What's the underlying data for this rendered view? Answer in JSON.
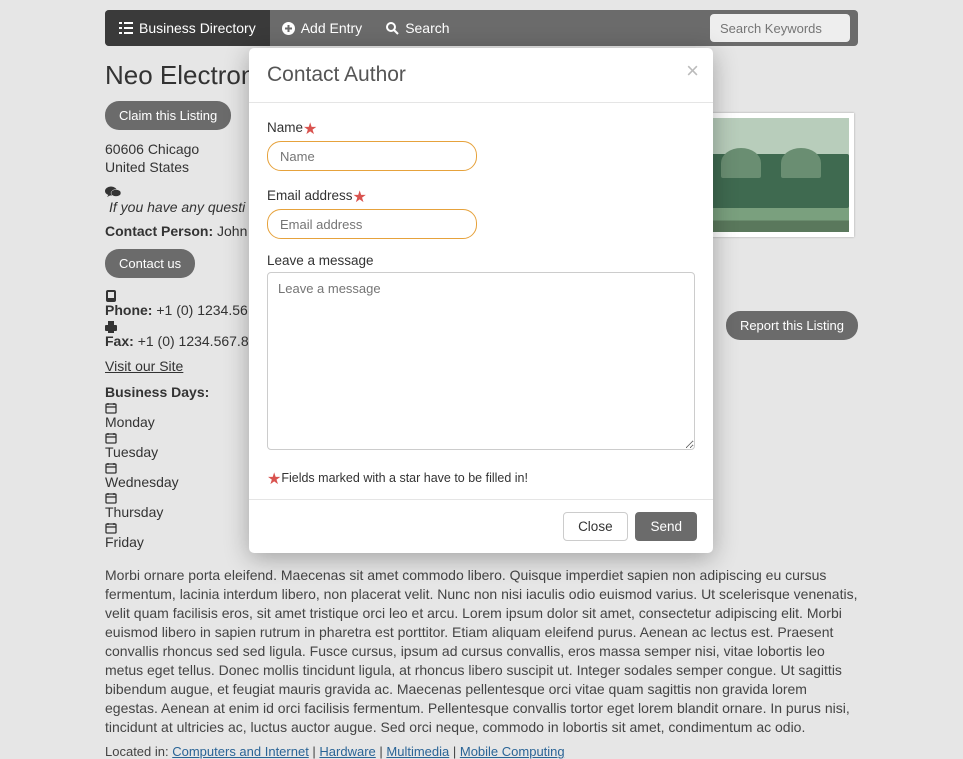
{
  "nav": {
    "directory_label": "Business Directory",
    "add_entry_label": "Add Entry",
    "search_label": "Search",
    "search_placeholder": "Search Keywords"
  },
  "listing": {
    "title": "Neo Electronics",
    "claim_label": "Claim this Listing",
    "address_line1": "60606 Chicago",
    "address_line2": "United States",
    "question_text": "If you have any questi",
    "contact_person_label": "Contact Person:",
    "contact_person_value": "John D",
    "contact_us_label": "Contact us",
    "phone_label": "Phone:",
    "phone_value": "+1 (0) 1234.56",
    "fax_label": "Fax:",
    "fax_value": "+1 (0) 1234.567.8",
    "visit_label": "Visit our Site",
    "bdays_title": "Business Days:",
    "bdays": [
      "Monday",
      "Tuesday",
      "Wednesday",
      "Thursday",
      "Friday"
    ],
    "report_label": "Report this Listing",
    "body": "Morbi ornare porta eleifend. Maecenas sit amet commodo libero. Quisque imperdiet sapien non adipiscing eu cursus fermentum, lacinia interdum libero, non placerat velit. Nunc non nisi iaculis odio euismod varius. Ut scelerisque venenatis, velit quam facilisis eros, sit amet tristique orci leo et arcu. Lorem ipsum dolor sit amet, consectetur adipiscing elit. Morbi euismod libero in sapien rutrum in pharetra est porttitor. Etiam aliquam eleifend purus. Aenean ac lectus est. Praesent convallis rhoncus sed sed ligula. Fusce cursus, ipsum ad cursus convallis, eros massa semper nisi, vitae lobortis leo metus eget tellus. Donec mollis tincidunt ligula, at rhoncus libero suscipit ut. Integer sodales semper congue. Ut sagittis bibendum augue, et feugiat mauris gravida ac. Maecenas pellentesque orci vitae quam sagittis non gravida lorem egestas. Aenean at enim id orci facilisis fermentum. Pellentesque convallis tortor eget lorem blandit ornare. In purus nisi, tincidunt at ultricies ac, luctus auctor augue. Sed orci neque, commodo in lobortis sit amet, condimentum ac odio.",
    "located_in_label": "Located in:",
    "categories": [
      "Computers and Internet",
      "Hardware",
      "Multimedia",
      "Mobile Computing"
    ]
  },
  "modal": {
    "title": "Contact Author",
    "name_label": "Name",
    "name_placeholder": "Name",
    "email_label": "Email address",
    "email_placeholder": "Email address",
    "message_label": "Leave a message",
    "message_placeholder": "Leave a message",
    "required_note": "Fields marked with a star have to be filled in!",
    "close_label": "Close",
    "send_label": "Send"
  }
}
